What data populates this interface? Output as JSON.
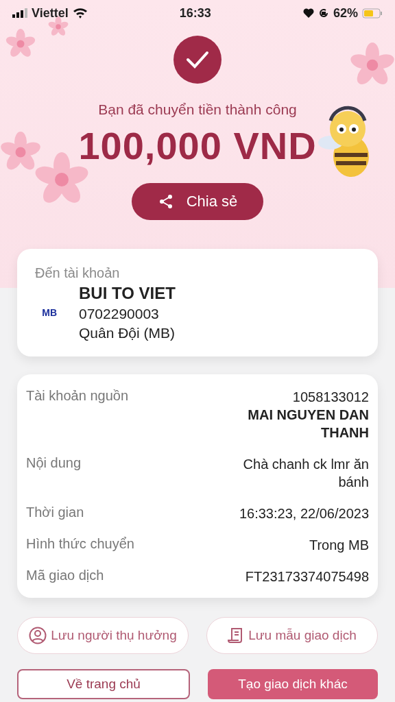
{
  "status_bar": {
    "carrier": "Viettel",
    "time": "16:33",
    "battery": "62%"
  },
  "result": {
    "message": "Bạn đã chuyển tiền thành công",
    "amount": "100,000 VND",
    "share_button": "Chia sẻ"
  },
  "recipient": {
    "heading": "Đến tài khoản",
    "bank_logo": "MB",
    "name": "BUI TO VIET",
    "account": "0702290003",
    "bank": "Quân Đội (MB)"
  },
  "details": [
    {
      "label": "Tài khoản nguồn",
      "values": [
        {
          "text": "1058133012",
          "emphasis": false
        },
        {
          "text": "MAI NGUYEN DAN THANH",
          "emphasis": true
        }
      ]
    },
    {
      "label": "Nội dung",
      "values": [
        {
          "text": "Chà chanh ck lmr ăn bánh",
          "emphasis": false
        }
      ]
    },
    {
      "label": "Thời gian",
      "values": [
        {
          "text": "16:33:23, 22/06/2023",
          "emphasis": false
        }
      ]
    },
    {
      "label": "Hình thức chuyển",
      "values": [
        {
          "text": "Trong MB",
          "emphasis": false
        }
      ]
    },
    {
      "label": "Mã giao dịch",
      "values": [
        {
          "text": "FT23173374075498",
          "emphasis": false
        }
      ]
    }
  ],
  "save_actions": [
    {
      "kind": "person",
      "label": "Lưu người thụ hưởng"
    },
    {
      "kind": "receipt",
      "label": "Lưu mẫu giao dịch"
    }
  ],
  "bottom_buttons": [
    {
      "kind": "outline",
      "label": "Về trang chủ"
    },
    {
      "kind": "filled",
      "label": "Tạo giao dịch khác"
    }
  ]
}
